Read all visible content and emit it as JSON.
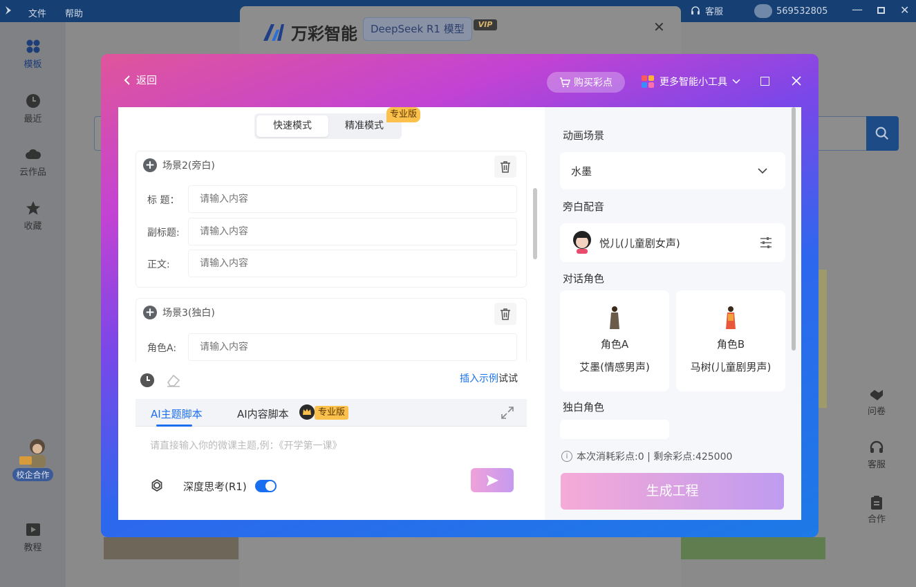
{
  "bg_app": {
    "menu": [
      "文件",
      "帮助"
    ],
    "service": "客服",
    "user_id": "569532805",
    "sidebar": [
      {
        "label": "模板",
        "icon": "grid-icon"
      },
      {
        "label": "最近",
        "icon": "clock-icon"
      },
      {
        "label": "云作品",
        "icon": "cloud-icon"
      },
      {
        "label": "收藏",
        "icon": "star-icon"
      },
      {
        "label": "校企合作",
        "icon": "mascot-icon"
      },
      {
        "label": "教程",
        "icon": "play-icon"
      }
    ],
    "right_tools": [
      {
        "label": "问卷",
        "icon": "handshake-icon"
      },
      {
        "label": "客服",
        "icon": "headset-icon"
      },
      {
        "label": "合作",
        "icon": "clipboard-icon"
      }
    ]
  },
  "mid_dialog": {
    "brand": "万彩智能",
    "model_badge": "DeepSeek R1 模型",
    "vip": "VIP"
  },
  "modal": {
    "back": "返回",
    "buy": "购买彩点",
    "more_tools": "更多智能小工具",
    "modes": {
      "fast": "快速模式",
      "precise": "精准模式",
      "pro_tag": "专业版"
    },
    "scenes": [
      {
        "title": "场景2(旁白)",
        "fields": [
          {
            "label": "标  题：",
            "placeholder": "请输入内容"
          },
          {
            "label": "副标题:",
            "placeholder": "请输入内容"
          },
          {
            "label": "正文:",
            "placeholder": "请输入内容"
          }
        ]
      },
      {
        "title": "场景3(独白)",
        "fields": [
          {
            "label": "角色A:",
            "placeholder": "请输入内容"
          }
        ]
      }
    ],
    "insert_example": {
      "link": "插入示例",
      "suffix": "试试"
    },
    "ai_tabs": {
      "topic": "AI主题脚本",
      "content": "AI内容脚本",
      "pro_tag": "专业版"
    },
    "ai_placeholder": "请直接输入你的微课主题,例：《开学第一课》",
    "deep_think": "深度思考(R1)",
    "deep_think_on": true,
    "right": {
      "scene_label": "动画场景",
      "scene_value": "水墨",
      "narration_label": "旁白配音",
      "narration_voice": "悦儿(儿童剧女声)",
      "roles_label": "对话角色",
      "roles": [
        {
          "name": "角色A",
          "voice": "艾墨(情感男声)"
        },
        {
          "name": "角色B",
          "voice": "马树(儿童剧男声)"
        }
      ],
      "mono_label": "独白角色",
      "cost": "本次消耗彩点:0 | 剩余彩点:425000",
      "generate": "生成工程"
    }
  }
}
